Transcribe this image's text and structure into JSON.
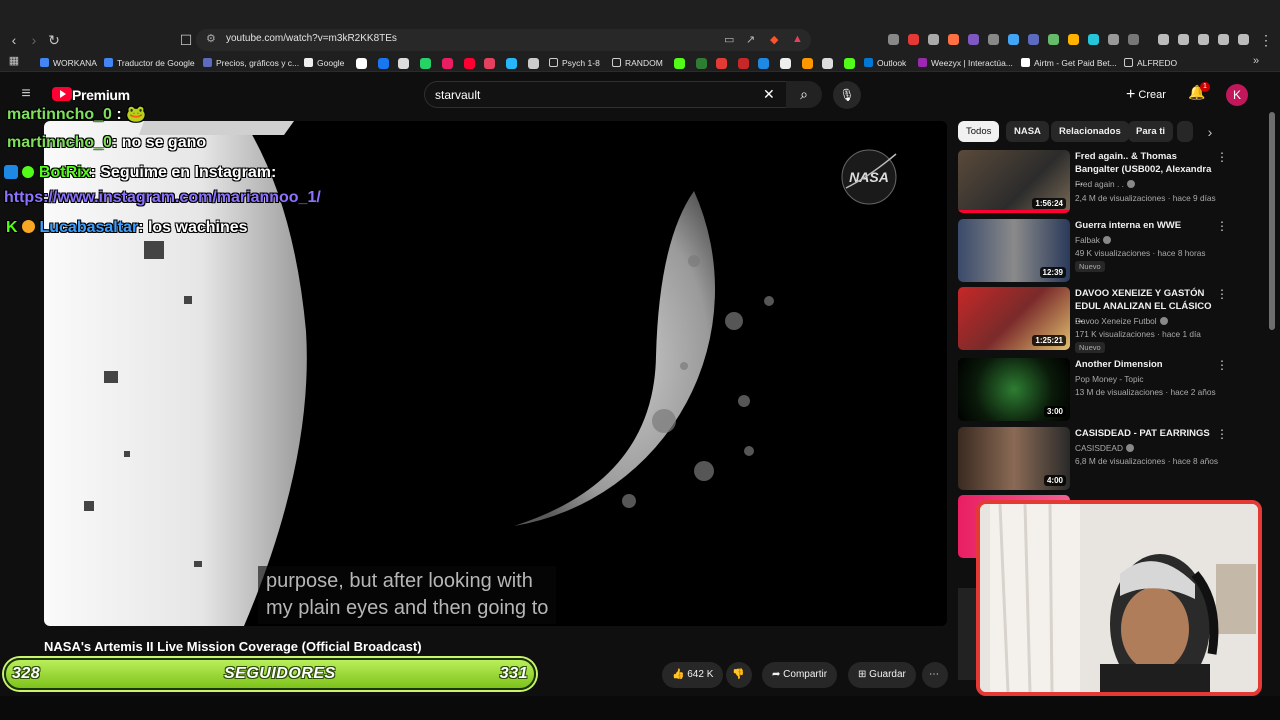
{
  "browser": {
    "url": "youtube.com/watch?v=m3kR2KK8TEs",
    "bookmarks": [
      "WORKANA",
      "Traductor de Google",
      "Precios, gráficos y c...",
      "Google",
      "Psych 1-8",
      "RANDOM",
      "Outlook",
      "Weezyx | Interactúa...",
      "Airtm - Get Paid Bet...",
      "ALFREDO"
    ]
  },
  "header": {
    "brand": "Premium",
    "search_value": "starvault",
    "create_label": "Crear",
    "notif_count": "1",
    "avatar_letter": "K"
  },
  "player": {
    "caption_line1": "purpose, but after looking with",
    "caption_line2": "my plain eyes and then going to",
    "logo_text": "NASA"
  },
  "video": {
    "title": "NASA's Artemis II Live Mission Coverage (Official Broadcast)",
    "likes": "642 K",
    "share_label": "Compartir",
    "save_label": "Guardar"
  },
  "overlay": {
    "chat": [
      {
        "user": "martinncho_0",
        "msg": ":"
      },
      {
        "user": "martinncho_0",
        "msg": ": no se gano"
      },
      {
        "user": "BotRix",
        "msg": ": Seguime en Instagram:"
      },
      {
        "user": "",
        "msg": "https://www.instagram.com/mariannoo_1/"
      },
      {
        "user": "Lucabasaltar",
        "msg": ": los wachines"
      }
    ],
    "followers": {
      "current": "328",
      "label": "SEGUIDORES",
      "goal": "331"
    }
  },
  "sidebar": {
    "chips": [
      "Todos",
      "NASA",
      "Relacionados",
      "Para ti"
    ],
    "recommendations": [
      {
        "title": "Fred again.. & Thomas Bangalter (USB002, Alexandra ...",
        "channel": "Fred again . .",
        "meta": "2,4 M de visualizaciones · hace 9 días",
        "duration": "1:56:24",
        "badge": ""
      },
      {
        "title": "Guerra interna en WWE",
        "channel": "Falbak",
        "meta": "49 K visualizaciones · hace 8 horas",
        "duration": "12:39",
        "badge": "Nuevo"
      },
      {
        "title": "DAVOO XENEIZE Y GASTÓN EDUL ANALIZAN EL CLÁSICO ...",
        "channel": "Davoo Xeneize Futbol",
        "meta": "171 K visualizaciones · hace 1 día",
        "duration": "1:25:21",
        "badge": "Nuevo"
      },
      {
        "title": "Another Dimension",
        "channel": "Pop Money - Topic",
        "meta": "13 M de visualizaciones · hace 2 años",
        "duration": "3:00",
        "badge": ""
      },
      {
        "title": "CASISDEAD - PAT EARRINGS",
        "channel": "CASISDEAD",
        "meta": "6,8 M de visualizaciones · hace 8 años",
        "duration": "4:00",
        "badge": ""
      }
    ]
  },
  "colors": {
    "accent": "#ff0033",
    "follow_bar": "#8fd12a",
    "webcam_border": "#e53935"
  }
}
